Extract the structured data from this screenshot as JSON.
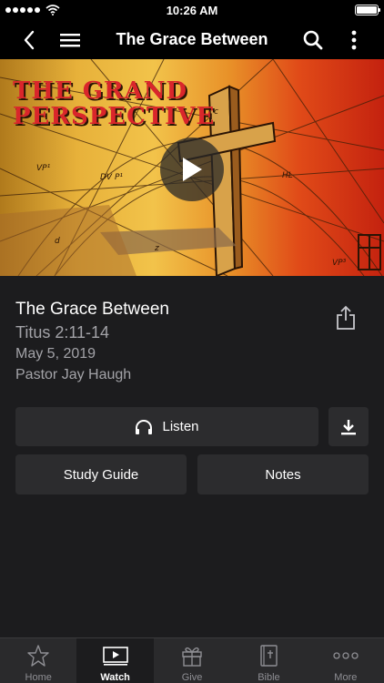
{
  "status_bar": {
    "time": "10:26 AM"
  },
  "nav": {
    "title": "The Grace Between",
    "back_icon": "chevron-left-icon",
    "menu_icon": "hamburger-menu-icon",
    "search_icon": "search-icon",
    "more_icon": "vertical-ellipsis-icon"
  },
  "hero": {
    "title_line1": "THE GRAND",
    "title_line2": "PERSPECTIVE",
    "play_icon": "play-icon"
  },
  "sermon": {
    "title": "The Grace Between",
    "scripture": "Titus 2:11-14",
    "date": "May 5, 2019",
    "speaker": "Pastor Jay Haugh",
    "share_icon": "share-icon"
  },
  "actions": {
    "listen_label": "Listen",
    "listen_icon": "headphones-icon",
    "download_icon": "download-icon",
    "study_guide_label": "Study Guide",
    "notes_label": "Notes"
  },
  "tabs": [
    {
      "label": "Home",
      "icon": "star-icon",
      "active": false
    },
    {
      "label": "Watch",
      "icon": "video-play-icon",
      "active": true
    },
    {
      "label": "Give",
      "icon": "gift-icon",
      "active": false
    },
    {
      "label": "Bible",
      "icon": "bible-icon",
      "active": false
    },
    {
      "label": "More",
      "icon": "ellipsis-icon",
      "active": false
    }
  ],
  "colors": {
    "background": "#1c1c1e",
    "button": "#2c2c2e",
    "secondary_text": "#a3a3a8",
    "hero_title": "#d9262b"
  }
}
